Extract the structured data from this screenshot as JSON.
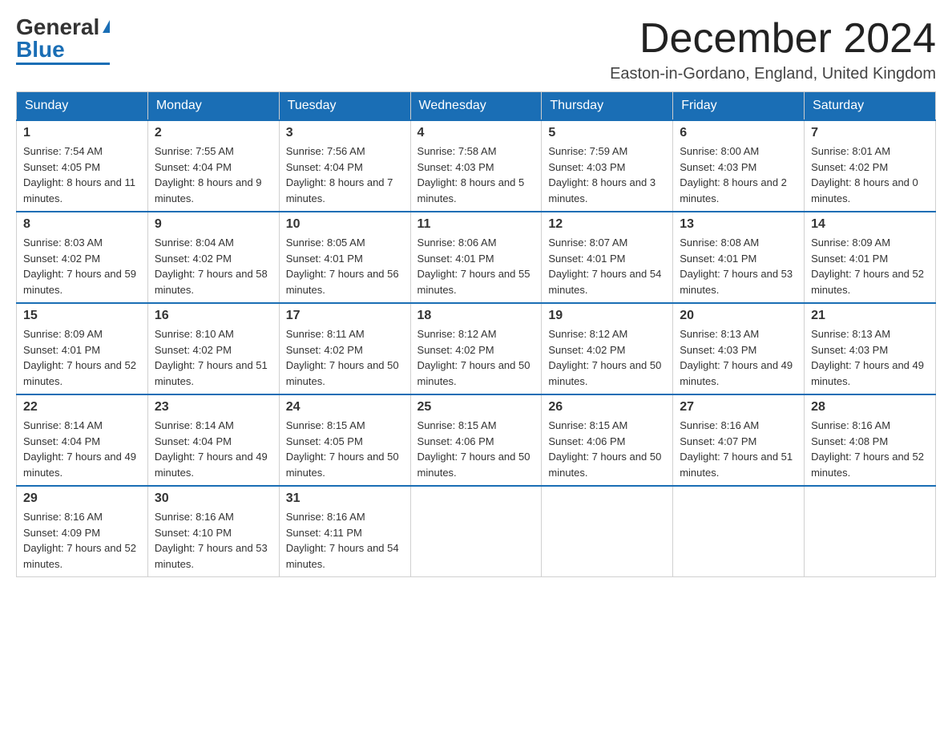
{
  "logo": {
    "general": "General",
    "blue": "Blue"
  },
  "title": "December 2024",
  "location": "Easton-in-Gordano, England, United Kingdom",
  "days_of_week": [
    "Sunday",
    "Monday",
    "Tuesday",
    "Wednesday",
    "Thursday",
    "Friday",
    "Saturday"
  ],
  "weeks": [
    [
      {
        "day": "1",
        "sunrise": "7:54 AM",
        "sunset": "4:05 PM",
        "daylight": "8 hours and 11 minutes."
      },
      {
        "day": "2",
        "sunrise": "7:55 AM",
        "sunset": "4:04 PM",
        "daylight": "8 hours and 9 minutes."
      },
      {
        "day": "3",
        "sunrise": "7:56 AM",
        "sunset": "4:04 PM",
        "daylight": "8 hours and 7 minutes."
      },
      {
        "day": "4",
        "sunrise": "7:58 AM",
        "sunset": "4:03 PM",
        "daylight": "8 hours and 5 minutes."
      },
      {
        "day": "5",
        "sunrise": "7:59 AM",
        "sunset": "4:03 PM",
        "daylight": "8 hours and 3 minutes."
      },
      {
        "day": "6",
        "sunrise": "8:00 AM",
        "sunset": "4:03 PM",
        "daylight": "8 hours and 2 minutes."
      },
      {
        "day": "7",
        "sunrise": "8:01 AM",
        "sunset": "4:02 PM",
        "daylight": "8 hours and 0 minutes."
      }
    ],
    [
      {
        "day": "8",
        "sunrise": "8:03 AM",
        "sunset": "4:02 PM",
        "daylight": "7 hours and 59 minutes."
      },
      {
        "day": "9",
        "sunrise": "8:04 AM",
        "sunset": "4:02 PM",
        "daylight": "7 hours and 58 minutes."
      },
      {
        "day": "10",
        "sunrise": "8:05 AM",
        "sunset": "4:01 PM",
        "daylight": "7 hours and 56 minutes."
      },
      {
        "day": "11",
        "sunrise": "8:06 AM",
        "sunset": "4:01 PM",
        "daylight": "7 hours and 55 minutes."
      },
      {
        "day": "12",
        "sunrise": "8:07 AM",
        "sunset": "4:01 PM",
        "daylight": "7 hours and 54 minutes."
      },
      {
        "day": "13",
        "sunrise": "8:08 AM",
        "sunset": "4:01 PM",
        "daylight": "7 hours and 53 minutes."
      },
      {
        "day": "14",
        "sunrise": "8:09 AM",
        "sunset": "4:01 PM",
        "daylight": "7 hours and 52 minutes."
      }
    ],
    [
      {
        "day": "15",
        "sunrise": "8:09 AM",
        "sunset": "4:01 PM",
        "daylight": "7 hours and 52 minutes."
      },
      {
        "day": "16",
        "sunrise": "8:10 AM",
        "sunset": "4:02 PM",
        "daylight": "7 hours and 51 minutes."
      },
      {
        "day": "17",
        "sunrise": "8:11 AM",
        "sunset": "4:02 PM",
        "daylight": "7 hours and 50 minutes."
      },
      {
        "day": "18",
        "sunrise": "8:12 AM",
        "sunset": "4:02 PM",
        "daylight": "7 hours and 50 minutes."
      },
      {
        "day": "19",
        "sunrise": "8:12 AM",
        "sunset": "4:02 PM",
        "daylight": "7 hours and 50 minutes."
      },
      {
        "day": "20",
        "sunrise": "8:13 AM",
        "sunset": "4:03 PM",
        "daylight": "7 hours and 49 minutes."
      },
      {
        "day": "21",
        "sunrise": "8:13 AM",
        "sunset": "4:03 PM",
        "daylight": "7 hours and 49 minutes."
      }
    ],
    [
      {
        "day": "22",
        "sunrise": "8:14 AM",
        "sunset": "4:04 PM",
        "daylight": "7 hours and 49 minutes."
      },
      {
        "day": "23",
        "sunrise": "8:14 AM",
        "sunset": "4:04 PM",
        "daylight": "7 hours and 49 minutes."
      },
      {
        "day": "24",
        "sunrise": "8:15 AM",
        "sunset": "4:05 PM",
        "daylight": "7 hours and 50 minutes."
      },
      {
        "day": "25",
        "sunrise": "8:15 AM",
        "sunset": "4:06 PM",
        "daylight": "7 hours and 50 minutes."
      },
      {
        "day": "26",
        "sunrise": "8:15 AM",
        "sunset": "4:06 PM",
        "daylight": "7 hours and 50 minutes."
      },
      {
        "day": "27",
        "sunrise": "8:16 AM",
        "sunset": "4:07 PM",
        "daylight": "7 hours and 51 minutes."
      },
      {
        "day": "28",
        "sunrise": "8:16 AM",
        "sunset": "4:08 PM",
        "daylight": "7 hours and 52 minutes."
      }
    ],
    [
      {
        "day": "29",
        "sunrise": "8:16 AM",
        "sunset": "4:09 PM",
        "daylight": "7 hours and 52 minutes."
      },
      {
        "day": "30",
        "sunrise": "8:16 AM",
        "sunset": "4:10 PM",
        "daylight": "7 hours and 53 minutes."
      },
      {
        "day": "31",
        "sunrise": "8:16 AM",
        "sunset": "4:11 PM",
        "daylight": "7 hours and 54 minutes."
      },
      null,
      null,
      null,
      null
    ]
  ]
}
